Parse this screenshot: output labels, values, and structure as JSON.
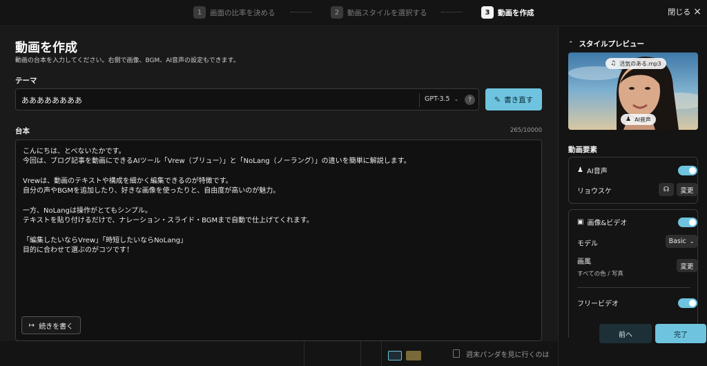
{
  "stepper": {
    "steps": [
      {
        "num": "1",
        "label": "画面の比率を決める"
      },
      {
        "num": "2",
        "label": "動画スタイルを選択する"
      },
      {
        "num": "3",
        "label": "動画を作成"
      }
    ],
    "active_step": 3,
    "close_label": "閉じる",
    "close_icon": "×"
  },
  "main": {
    "title": "動画を作成",
    "subtitle": "動画の台本を入力してください。右側で画像、BGM、AI音声の設定もできます。",
    "theme_label": "テーマ",
    "theme_value": "ああああああああ",
    "model_select": "GPT-3.5",
    "model_chevron": "⌄",
    "help_icon": "?",
    "rewrite_icon": "✎",
    "rewrite_label": "書き直す",
    "script_label": "台本",
    "char_counter": "265/10000",
    "script_lines": [
      "こんにちは、とべないたかです。",
      "今回は、ブログ記事を動画にできるAIツール「Vrew（ブリュー）」と「NoLang（ノーラング）」の違いを簡単に解説します。",
      "",
      "Vrewは、動画のテキストや構成を細かく編集できるのが特徴です。",
      "自分の声やBGMを追加したり、好きな画像を使ったりと、自由度が高いのが魅力。",
      "",
      "一方、NoLangは操作がとてもシンプル。",
      "テキストを貼り付けるだけで、ナレーション・スライド・BGMまで自動で仕上げてくれます。",
      "",
      "「編集したいならVrew」「時短したいならNoLang」",
      "目的に合わせて選ぶのがコツです！"
    ],
    "continue_icon": "↦",
    "continue_label": "続きを書く",
    "bottom_strip_text": "週末パンダを見に行くのは"
  },
  "side": {
    "preview_chevron": "⌃",
    "preview_title": "スタイルプレビュー",
    "bgm_icon": "♫",
    "bgm_tag": "活気のある.mp3",
    "voice_icon": "♟",
    "voice_tag": "AI音声",
    "elements_title": "動画要素",
    "ai_voice": {
      "icon": "♟",
      "label": "AI音声",
      "enabled": true,
      "speaker": "リョウスケ",
      "listen_icon": "☊",
      "change_label": "変更"
    },
    "media": {
      "icon": "▣",
      "label": "画像&ビデオ",
      "enabled": true,
      "model_label": "モデル",
      "model_value": "Basic",
      "model_chevron": "⌄",
      "style_label": "画風",
      "style_value": "すべての色 / 写真",
      "change_label": "変更",
      "free_video_label": "フリービデオ",
      "free_video_enabled": true
    },
    "prev_label": "前へ",
    "done_label": "完了"
  },
  "colors": {
    "accent": "#6ec4df",
    "background": "#1a1a1a",
    "panel": "#141414"
  }
}
